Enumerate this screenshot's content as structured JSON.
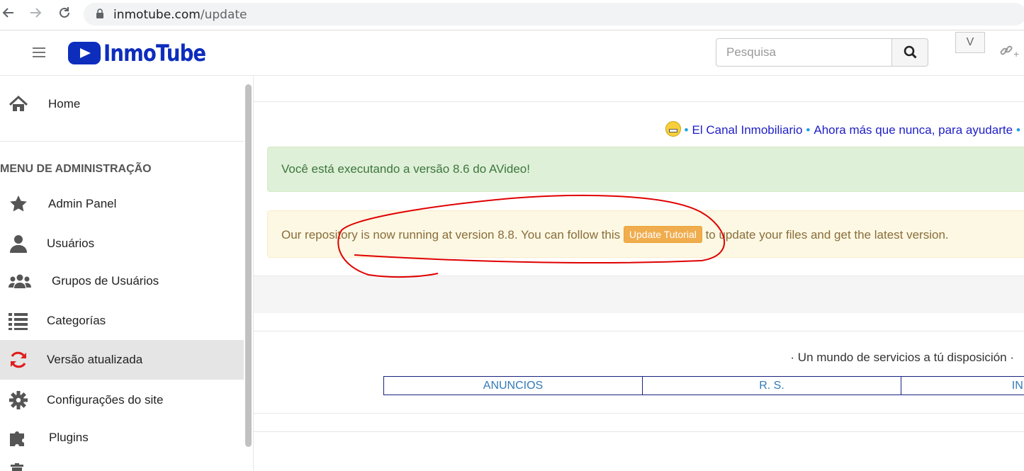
{
  "browser": {
    "url_host": "inmotube.com",
    "url_path": "/update",
    "icons": [
      "back-icon",
      "forward-icon",
      "reload-icon",
      "lock-icon"
    ]
  },
  "header": {
    "logo_text": "InmoTube",
    "search_placeholder": "Pesquisa",
    "user_button_label": "V",
    "link_text": "+"
  },
  "sidebar": {
    "home_label": "Home",
    "admin_header": "MENU DE ADMINISTRAÇÃO",
    "items": [
      {
        "label": "Admin Panel",
        "icon": "star-icon"
      },
      {
        "label": "Usuários",
        "icon": "user-icon"
      },
      {
        "label": "Grupos de Usuários",
        "icon": "users-icon"
      },
      {
        "label": "Categorías",
        "icon": "list-icon"
      },
      {
        "label": "Versão atualizada",
        "icon": "refresh-icon",
        "active": true
      },
      {
        "label": "Configurações do site",
        "icon": "gear-icon"
      },
      {
        "label": "Plugins",
        "icon": "puzzle-icon"
      }
    ]
  },
  "content": {
    "marquee": [
      "El Canal Inmobiliario",
      "Ahora más que nunca, para ayudarte"
    ],
    "success_message": "Você está executando a versão 8.6 do AVideo!",
    "warning_before": "Our repository is now running at version 8.8. You can follow this",
    "update_button": "Update Tutorial",
    "warning_after": "to update your files and get the latest version.",
    "footer_text": "· Un mundo de servicios a tú disposición ·",
    "footer_table": [
      "ANUNCIOS",
      "R. S.",
      "INMOB"
    ]
  },
  "colors": {
    "brand": "#0d2dbd",
    "success_bg": "#dff0d8",
    "warning_bg": "#fcf8e3",
    "update_button": "#f0ad4e",
    "annotation": "#e00000"
  }
}
